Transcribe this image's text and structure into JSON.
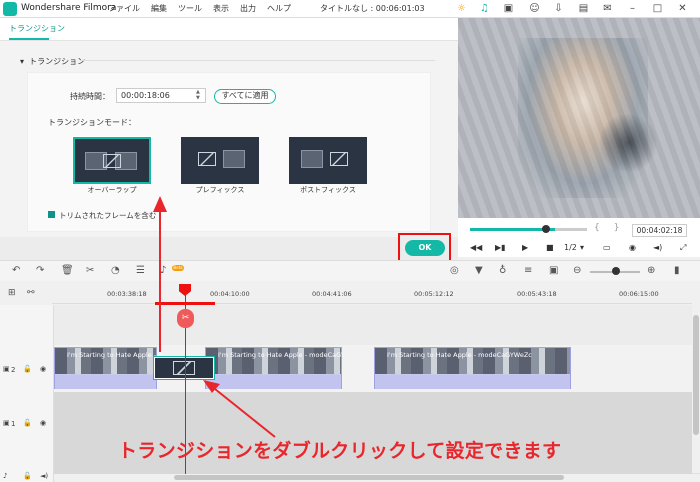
{
  "app": {
    "name": "Wondershare Filmora",
    "doc_title": "タイトルなし : 00:06:01:03"
  },
  "menu": [
    "ファイル",
    "編集",
    "ツール",
    "表示",
    "出力",
    "ヘルプ"
  ],
  "titlebar_icons": [
    "sun-icon",
    "headset-icon",
    "gift-icon",
    "user-icon",
    "download-icon",
    "save-icon",
    "mail-icon",
    "minimize-icon",
    "maximize-icon",
    "close-icon"
  ],
  "panel": {
    "tab": "トランジション",
    "section": "トランジション",
    "duration_label": "持続時間：",
    "duration_value": "00:00:18:06",
    "apply_all": "すべてに適用",
    "mode_label": "トランジションモード：",
    "modes": [
      {
        "label": "オーバーラップ",
        "selected": true
      },
      {
        "label": "プレフィックス",
        "selected": false
      },
      {
        "label": "ポストフィックス",
        "selected": false
      }
    ],
    "trim_label": "トリムされたフレームを含む",
    "trim_checked": true,
    "ok": "OK"
  },
  "preview": {
    "timecode": "00:04:02:18",
    "progress": 0.73,
    "bracket_open": "{",
    "bracket_close": "}",
    "quality": "1/2"
  },
  "ruler": {
    "ticks": [
      "00:03:38:18",
      "00:04:10:00",
      "00:04:41:06",
      "00:05:12:12",
      "00:05:43:18",
      "00:06:15:00"
    ]
  },
  "timeline": {
    "clip1_name": "I'm Starting to Hate Apple - modeCaGYWeZc",
    "clip2_name": "I'm Starting to Hate Apple - modeCaGYWeZc",
    "clip3_name": "I'm Starting to Hate Apple - modeCaGYWeZc",
    "track2_label": "2",
    "track1_label": "1",
    "beta": "Beta"
  },
  "annotation": "トランジションをダブルクリックして設定できます",
  "colors": {
    "accent": "#14b8a6",
    "annotation": "#e8262b",
    "clip": "#c7c9ee"
  }
}
